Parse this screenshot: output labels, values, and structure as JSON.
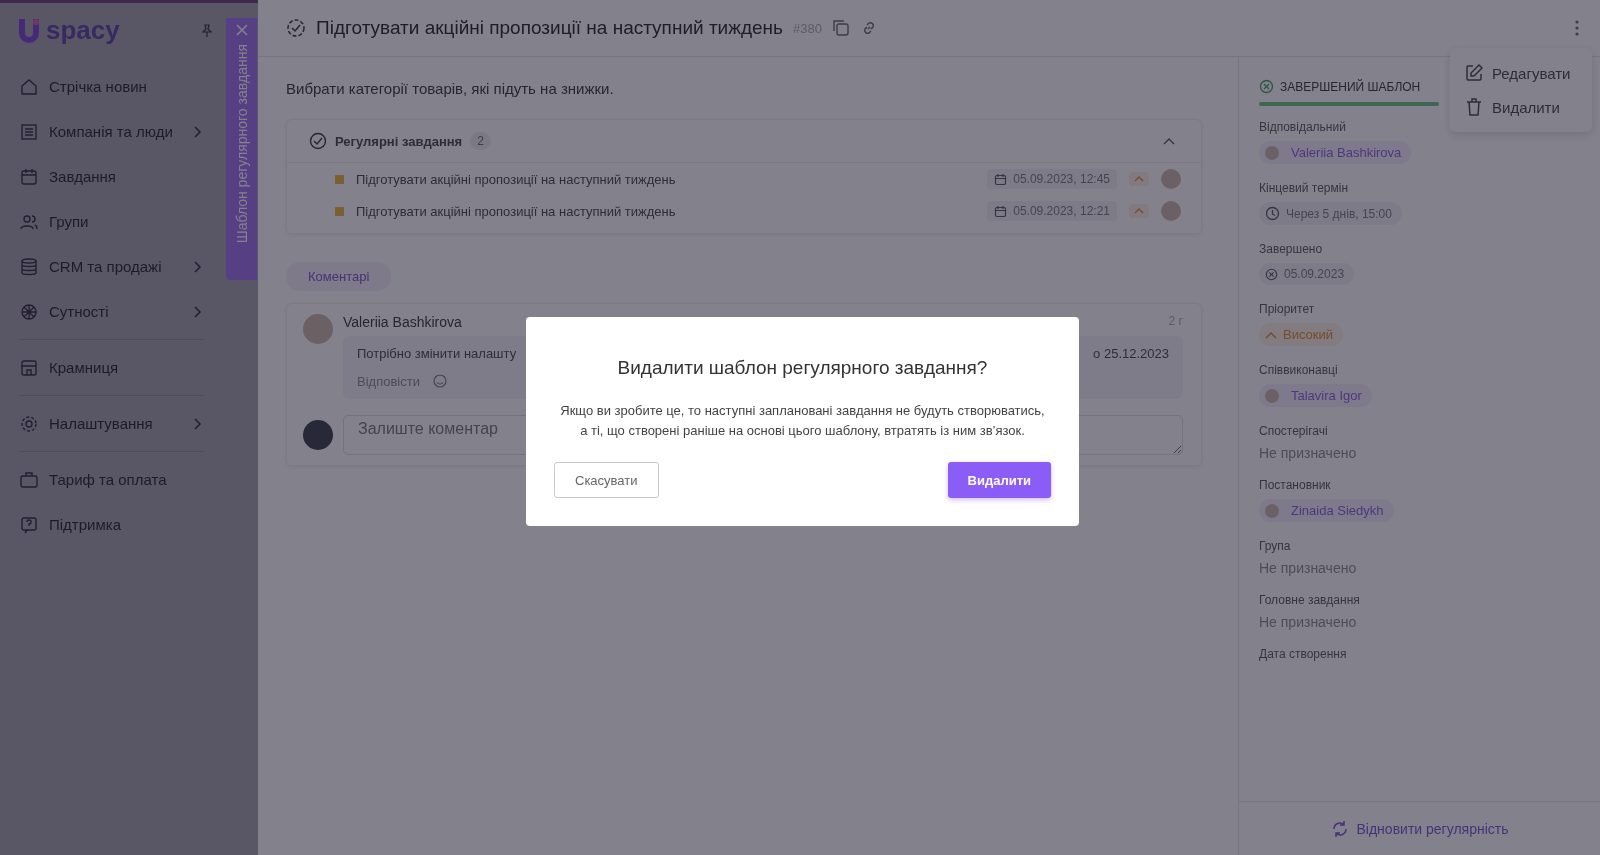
{
  "sidebar": {
    "logo": "spacy",
    "sections": [
      [
        {
          "label": "Стрічка новин",
          "submenu": false
        },
        {
          "label": "Компанія та люди",
          "submenu": true
        },
        {
          "label": "Завдання",
          "submenu": false
        },
        {
          "label": "Групи",
          "submenu": false
        },
        {
          "label": "CRM та продажі",
          "submenu": true
        },
        {
          "label": "Сутності",
          "submenu": true
        }
      ],
      [
        {
          "label": "Крамниця",
          "submenu": false
        }
      ],
      [
        {
          "label": "Налаштування",
          "submenu": true
        }
      ],
      [
        {
          "label": "Тариф та оплата",
          "submenu": false
        },
        {
          "label": "Підтримка",
          "submenu": false
        }
      ]
    ]
  },
  "side_tab": {
    "label": "Шаблон регулярного завдання"
  },
  "header": {
    "title": "Підготувати акційні пропозиції на наступний тиждень",
    "number": "#380"
  },
  "description": "Вибрати категорії товарів, які підуть на знижки.",
  "regular_tasks": {
    "title": "Регулярні завдання",
    "count": "2",
    "expanded": true,
    "rows": [
      {
        "title": "Підготувати акційні пропозиції на наступний тиждень",
        "date": "05.09.2023, 12:45"
      },
      {
        "title": "Підготувати акційні пропозиції на наступний тиждень",
        "date": "05.09.2023, 12:21"
      }
    ]
  },
  "comments_tab": "Коментарі",
  "comment": {
    "author": "Valeriia Bashkirova",
    "time": "2 г",
    "text_start": "Потрібно змінити налашту",
    "text_end": "о 25.12.2023",
    "reply": "Відповісти"
  },
  "comment_input": {
    "placeholder": "Залиште коментар"
  },
  "status": {
    "label": "ЗАВЕРШЕНИЙ ШАБЛОН"
  },
  "fields": [
    {
      "label": "Відповідальний",
      "kind": "person",
      "value": "Valeriia Bashkirova"
    },
    {
      "label": "Кінцевий термін",
      "kind": "deadline",
      "value": "Через 5 днів, 15:00"
    },
    {
      "label": "Завершено",
      "kind": "completed",
      "value": "05.09.2023"
    },
    {
      "label": "Пріоритет",
      "kind": "priority",
      "value": "Високий"
    },
    {
      "label": "Співвиконавці",
      "kind": "person",
      "value": "Talavira Igor"
    },
    {
      "label": "Спостерігачі",
      "kind": "empty",
      "value": "Не призначено"
    },
    {
      "label": "Постановник",
      "kind": "person",
      "value": "Zinaida Siedykh"
    },
    {
      "label": "Група",
      "kind": "empty",
      "value": "Не призначено"
    },
    {
      "label": "Головне завдання",
      "kind": "empty",
      "value": "Не призначено"
    },
    {
      "label": "Дата створення",
      "kind": "hidden"
    }
  ],
  "restore_button": "Відновити регулярність",
  "menu": [
    {
      "label": "Редагувати",
      "kind": "edit"
    },
    {
      "label": "Видалити",
      "kind": "delete"
    }
  ],
  "dialog": {
    "title": "Видалити шаблон регулярного завдання?",
    "message": "Якщо ви зробите це, то наступні заплановані завдання не будуть створюватись, а ті, що створені раніше на основі цього шаблону, втратять із ним зв’язок.",
    "cancel": "Скасувати",
    "confirm": "Видалити"
  }
}
